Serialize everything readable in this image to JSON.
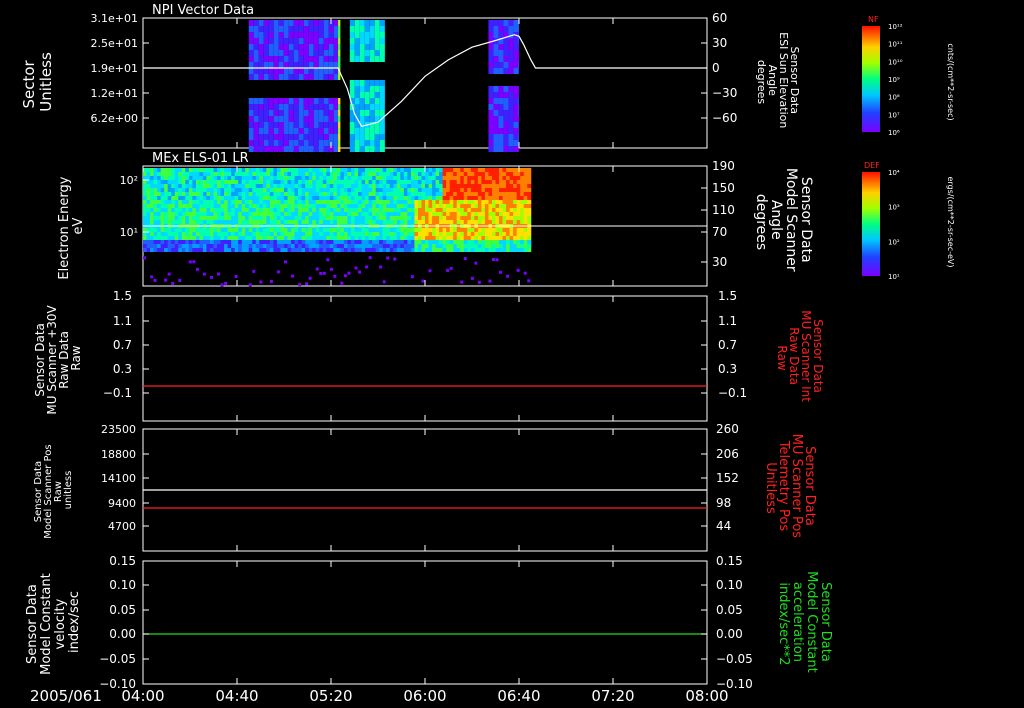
{
  "time_axis": {
    "date_label": "2005/061",
    "ticks": [
      "04:00",
      "04:40",
      "05:20",
      "06:00",
      "06:40",
      "07:20",
      "08:00"
    ],
    "range_minutes": [
      240,
      480
    ]
  },
  "panels": [
    {
      "title": "NPI Vector Data",
      "left_label": [
        "Sector",
        "Unitless"
      ],
      "left_ticks": [
        "3.1e+01",
        "2.5e+01",
        "1.9e+01",
        "1.2e+01",
        "6.2e+00"
      ],
      "right_label": [
        "Sensor Data",
        "ESI Sun Elevation",
        "Angle",
        "degrees"
      ],
      "right_ticks": [
        "60",
        "30",
        "0",
        "−30",
        "−60"
      ],
      "colorbar": {
        "label": "NF",
        "unit": "cnts/(cm**2-sr-sec)",
        "ticks": [
          "10¹²",
          "10¹¹",
          "10¹⁰",
          "10⁹",
          "10⁸",
          "10⁷",
          "10⁶"
        ]
      }
    },
    {
      "title": "MEx ELS-01 LR",
      "left_label": [
        "Electron Energy",
        "eV"
      ],
      "left_ticks": [
        "10²",
        "10¹"
      ],
      "right_label": [
        "Sensor Data",
        "Model Scanner",
        "Angle",
        "degrees"
      ],
      "right_ticks": [
        "190",
        "150",
        "110",
        "70",
        "30"
      ],
      "colorbar": {
        "label": "DEF",
        "unit": "ergs/(cm**2-sr-sec-eV)",
        "ticks": [
          "10⁴",
          "10³",
          "10²",
          "10¹"
        ]
      }
    },
    {
      "title": "",
      "left_label": [
        "Sensor Data",
        "MU Scanner +30V",
        "Raw Data",
        "Raw"
      ],
      "left_ticks": [
        "1.5",
        "1.1",
        "0.7",
        "0.3",
        "−0.1"
      ],
      "right_label": [
        "Sensor Data",
        "MU Scanner Int",
        "Raw Data",
        "Raw"
      ],
      "right_ticks": [
        "1.5",
        "1.1",
        "0.7",
        "0.3",
        "−0.1"
      ]
    },
    {
      "title": "",
      "left_label": [
        "Sensor Data",
        "Model Scanner Pos",
        "Raw",
        "unitless"
      ],
      "left_ticks": [
        "23500",
        "18800",
        "14100",
        "9400",
        "4700"
      ],
      "right_label": [
        "Sensor Data",
        "MU Scanner Pos",
        "Telemetry Pos",
        "Unitless"
      ],
      "right_ticks": [
        "260",
        "206",
        "152",
        "98",
        "44"
      ]
    },
    {
      "title": "",
      "left_label": [
        "Sensor Data",
        "Model Constant",
        "velocity",
        "index/sec"
      ],
      "left_ticks": [
        "0.15",
        "0.10",
        "0.05",
        "0.00",
        "−0.05",
        "−0.10"
      ],
      "right_label": [
        "Sensor Data",
        "Model Constant",
        "acceleration",
        "index/sec**2"
      ],
      "right_ticks": [
        "0.15",
        "0.10",
        "0.05",
        "0.00",
        "−0.05",
        "−0.10"
      ]
    }
  ],
  "colors": {
    "background": "#000000",
    "foreground": "#ffffff",
    "trace_red": "#ff2020",
    "trace_green": "#20dd20",
    "right_label_panel3": "#ff2020",
    "right_label_panel4": "#ff2020",
    "right_label_panel5": "#20dd20"
  },
  "chart_data": [
    {
      "type": "heatmap",
      "title": "NPI Vector Data",
      "xlabel": "",
      "ylabel": "Sector Unitless",
      "x_range": [
        "04:00",
        "08:00"
      ],
      "ylim": [
        0,
        31
      ],
      "data_blocks": [
        {
          "t_start": "04:45",
          "t_end": "05:23",
          "level": "1e7-1e8"
        },
        {
          "t_start": "05:23",
          "t_end": "05:24",
          "level": "1e9-1e10"
        },
        {
          "t_start": "05:28",
          "t_end": "05:43",
          "level": "1e8-1e9"
        },
        {
          "t_start": "06:27",
          "t_end": "06:40",
          "level": "1e7"
        }
      ],
      "line_series": {
        "name": "ESI Sun Elevation Angle",
        "x": [
          "04:00",
          "05:20",
          "05:23",
          "05:27",
          "05:30",
          "05:33",
          "05:40",
          "05:50",
          "06:00",
          "06:10",
          "06:20",
          "06:30",
          "06:38",
          "06:40",
          "06:42",
          "06:45",
          "06:47",
          "08:00"
        ],
        "y": [
          0,
          0,
          0,
          -25,
          -55,
          -70,
          -65,
          -40,
          -10,
          10,
          25,
          33,
          40,
          38,
          28,
          10,
          0,
          0
        ],
        "ylim": [
          -90,
          60
        ]
      }
    },
    {
      "type": "heatmap",
      "title": "MEx ELS-01 LR",
      "ylabel": "Electron Energy eV",
      "yscale": "log",
      "ylim": [
        1,
        200
      ],
      "x_range": [
        "04:00",
        "06:44"
      ],
      "intensity_profile": [
        {
          "t": "04:00",
          "level": "1e2-1e3"
        },
        {
          "t": "04:40",
          "level": "1e2-1e3"
        },
        {
          "t": "05:10",
          "level": "1e2"
        },
        {
          "t": "05:40",
          "level": "1e2-1e3"
        },
        {
          "t": "06:00",
          "level": "1e3"
        },
        {
          "t": "06:10",
          "level": "1e4"
        },
        {
          "t": "06:40",
          "level": "1e4"
        }
      ],
      "line_series": {
        "name": "Model Scanner Angle",
        "x": [
          "04:00",
          "08:00"
        ],
        "y": [
          90,
          90
        ],
        "ylim": [
          0,
          190
        ]
      }
    },
    {
      "type": "line",
      "series": [
        {
          "name": "MU Scanner Int Raw",
          "x": [
            "04:00",
            "08:00"
          ],
          "y": [
            0.0,
            0.0
          ],
          "color": "#ff2020"
        }
      ],
      "ylim": [
        -0.3,
        1.5
      ]
    },
    {
      "type": "line",
      "series": [
        {
          "name": "Model Scanner Pos Raw",
          "x": [
            "04:00",
            "08:00"
          ],
          "y": [
            11500,
            11500
          ],
          "color": "#ffffff"
        },
        {
          "name": "MU Scanner Pos Telemetry",
          "x": [
            "04:00",
            "08:00"
          ],
          "y": [
            103,
            103
          ],
          "color": "#ff2020"
        }
      ],
      "ylim": [
        0,
        23500
      ]
    },
    {
      "type": "line",
      "series": [
        {
          "name": "Model Constant velocity",
          "x": [
            "04:00",
            "08:00"
          ],
          "y": [
            0.0,
            0.0
          ],
          "color": "#20dd20"
        }
      ],
      "ylim": [
        -0.1,
        0.15
      ]
    }
  ]
}
